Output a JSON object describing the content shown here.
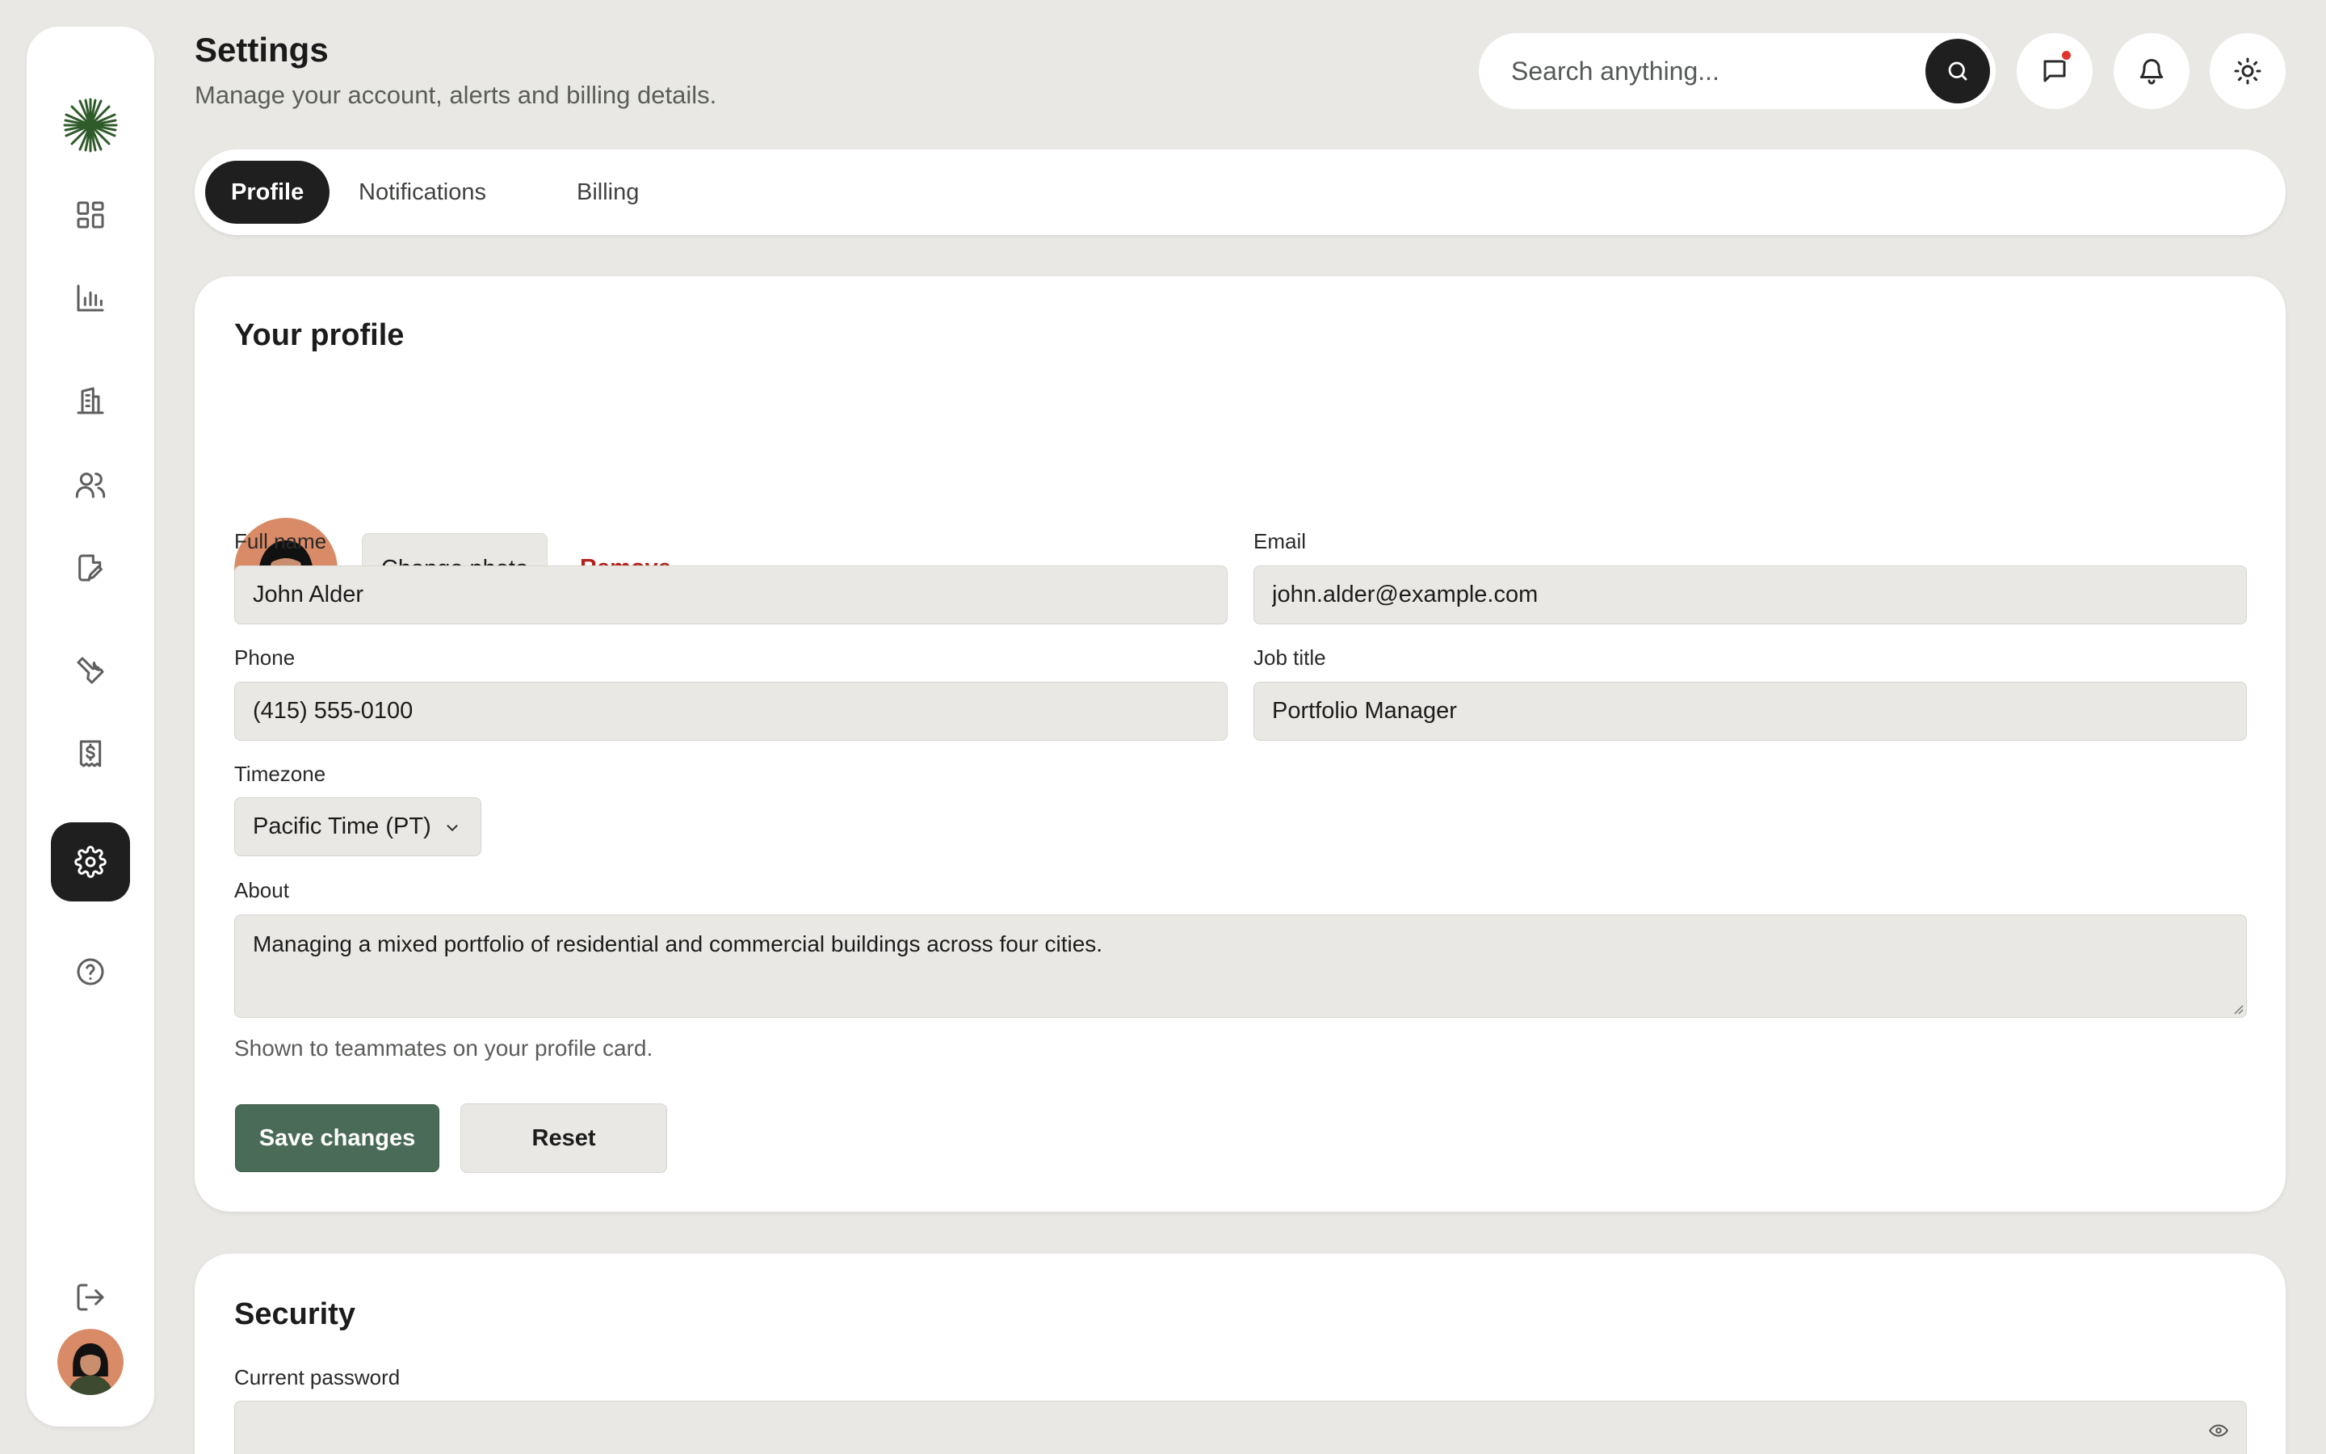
{
  "header": {
    "title": "Settings",
    "subtitle": "Manage your account, alerts and billing details."
  },
  "search": {
    "placeholder": "Search anything..."
  },
  "header_icons": [
    "search-icon",
    "message-icon",
    "bell-icon",
    "sun-icon"
  ],
  "sidebar": {
    "logo": "sunburst-logo",
    "items": [
      {
        "icon": "grid-icon"
      },
      {
        "icon": "bar-chart-icon"
      },
      {
        "icon": "building-icon"
      },
      {
        "icon": "users-icon"
      },
      {
        "icon": "file-edit-icon"
      },
      {
        "icon": "wrench-icon"
      },
      {
        "icon": "receipt-icon"
      },
      {
        "icon": "gear-icon",
        "active": true
      },
      {
        "icon": "help-icon"
      },
      {
        "icon": "logout-icon"
      }
    ]
  },
  "tabs": [
    {
      "label": "Profile",
      "active": true
    },
    {
      "label": "Notifications"
    },
    {
      "label": "Billing"
    }
  ],
  "profile": {
    "title": "Your profile",
    "change_photo": "Change photo",
    "remove": "Remove",
    "full_name_label": "Full name",
    "full_name_value": "John Alder",
    "email_label": "Email",
    "email_value": "john.alder@example.com",
    "phone_label": "Phone",
    "phone_value": "(415) 555-0100",
    "job_title_label": "Job title",
    "job_title_value": "Portfolio Manager",
    "timezone_label": "Timezone",
    "timezone_value": "Pacific Time (PT)",
    "about_label": "About",
    "about_value": "Managing a mixed portfolio of residential and commercial buildings across four cities.",
    "about_hint": "Shown to teammates on your profile card.",
    "save_label": "Save changes",
    "reset_label": "Reset"
  },
  "security": {
    "title": "Security",
    "current_password_label": "Current password"
  },
  "colors": {
    "background": "#e9e8e4",
    "accent_dark": "#1f1f1f",
    "save_green": "#496b57",
    "remove_red": "#b2221b",
    "notification_dot": "#e0352b"
  }
}
